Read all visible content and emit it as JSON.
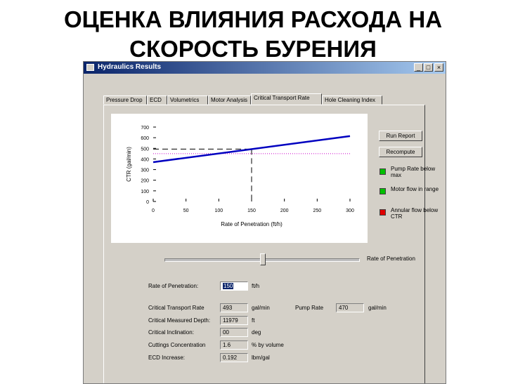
{
  "slide": {
    "title_line1": "ОЦЕНКА ВЛИЯНИЯ РАСХОДА НА",
    "title_line2": "СКОРОСТЬ БУРЕНИЯ"
  },
  "window": {
    "title": "Hydraulics Results",
    "min_glyph": "_",
    "max_glyph": "□",
    "close_glyph": "×"
  },
  "tabs": [
    {
      "label": "Pressure Drop"
    },
    {
      "label": "ECD"
    },
    {
      "label": "Volumetrics"
    },
    {
      "label": "Motor Analysis"
    },
    {
      "label": "Critical Transport Rate",
      "active": true
    },
    {
      "label": "Hole Cleaning Index"
    }
  ],
  "buttons": {
    "run_report": "Run Report",
    "recompute": "Recompute"
  },
  "status": [
    {
      "label": "Pump Rate below max",
      "color": "#00c000"
    },
    {
      "label": "Motor flow in range",
      "color": "#00c000"
    },
    {
      "label": "Annular flow below CTR",
      "color": "#e00000"
    }
  ],
  "slider": {
    "label": "Rate of Penetration"
  },
  "form": {
    "rop_label": "Rate of Penetration:",
    "rop_value": "150",
    "rop_unit": "ft/h",
    "ctr_label": "Critical Transport Rate",
    "ctr_value": "493",
    "ctr_unit": "gal/min",
    "pump_label": "Pump Rate",
    "pump_value": "470",
    "pump_unit": "gal/min",
    "depth_label": "Critical Measured Depth:",
    "depth_value": "11979",
    "depth_unit": "ft",
    "incl_label": "Critical Inclination:",
    "incl_value": "00",
    "incl_unit": "deg",
    "conc_label": "Cuttings Concentration",
    "conc_value": "1.6",
    "conc_unit": "% by volume",
    "ecd_label": "ECD Increase:",
    "ecd_value": "0.192",
    "ecd_unit": "lbm/gal"
  },
  "chart_data": {
    "type": "line",
    "xlabel": "Rate of Penetration (ft/h)",
    "ylabel": "CTR (gal/min)",
    "xlim": [
      0,
      300
    ],
    "ylim": [
      0,
      700
    ],
    "xticks": [
      0,
      50,
      100,
      150,
      200,
      250,
      300
    ],
    "yticks": [
      0,
      100,
      200,
      300,
      400,
      500,
      600,
      700
    ],
    "series": [
      {
        "x": [
          0,
          300
        ],
        "y": [
          370,
          615
        ],
        "color": "#0000c0",
        "style": "solid"
      }
    ],
    "pump_rate_line": {
      "y": 450,
      "color": "#cc00cc",
      "style": "dotted"
    },
    "operating_point": {
      "x": 150,
      "y": 493,
      "color": "#000000",
      "style": "dashed"
    }
  }
}
